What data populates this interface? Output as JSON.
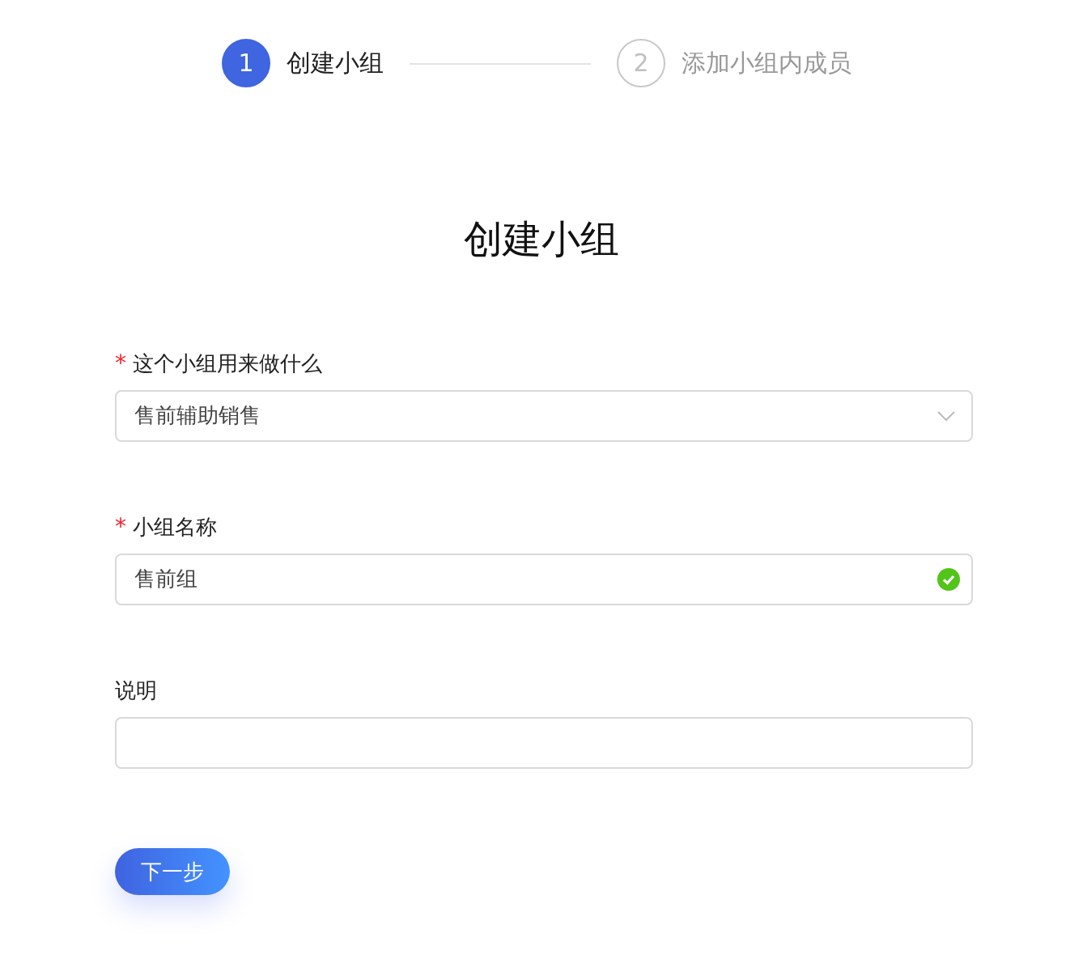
{
  "steps": [
    {
      "number": "1",
      "label": "创建小组",
      "selected": true
    },
    {
      "number": "2",
      "label": "添加小组内成员",
      "selected": false
    }
  ],
  "title": "创建小组",
  "fields": [
    {
      "kind": "select",
      "label": "这个小组用来做什么",
      "required_mark": "*",
      "value": "售前辅助销售"
    },
    {
      "kind": "text",
      "label": "小组名称",
      "required_mark": "*",
      "value": "售前组",
      "valid": true
    },
    {
      "kind": "text",
      "label": "说明",
      "valid": false
    }
  ],
  "next_button": "下一步"
}
